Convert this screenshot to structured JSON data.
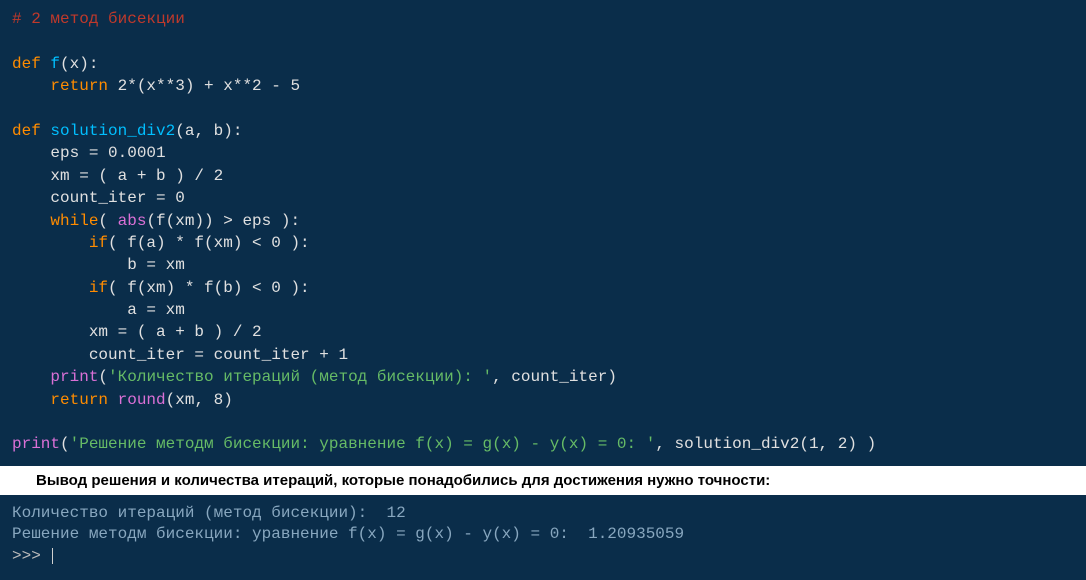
{
  "code": {
    "l1_comment": "# 2 метод бисекции",
    "l3_def": "def ",
    "l3_fname": "f",
    "l3_rest": "(x):",
    "l4_kw": "    return ",
    "l4_rest": "2*(x**3) + x**2 - 5",
    "l6_def": "def ",
    "l6_fname": "solution_div2",
    "l6_rest": "(a, b):",
    "l7": "    eps = 0.0001",
    "l8": "    xm = ( a + b ) / 2",
    "l9": "    count_iter = 0",
    "l10_kw": "    while",
    "l10_rest_a": "( ",
    "l10_abs": "abs",
    "l10_rest_b": "(f(xm)) > eps ):",
    "l11_kw": "        if",
    "l11_rest": "( f(a) * f(xm) < 0 ):",
    "l12": "            b = xm",
    "l13_kw": "        if",
    "l13_rest": "( f(xm) * f(b) < 0 ):",
    "l14": "            a = xm",
    "l15": "        xm = ( a + b ) / 2",
    "l16": "        count_iter = count_iter + 1",
    "l17_pr": "    print",
    "l17_p1": "(",
    "l17_str": "'Количество итераций (метод бисекции): '",
    "l17_rest": ", count_iter)",
    "l18_kw": "    return ",
    "l18_round": "round",
    "l18_rest": "(xm, 8)",
    "l20_pr": "print",
    "l20_p1": "(",
    "l20_str": "'Решение методм бисекции: уравнение f(x) = g(x) - y(x) = 0: '",
    "l20_rest": ", solution_div2(1, 2) )"
  },
  "caption": "Вывод решения и количества итераций, которые понадобились для достижения нужно точности:",
  "console": {
    "line1": "Количество итераций (метод бисекции):  12",
    "line2": "Решение методм бисекции: уравнение f(x) = g(x) - y(x) = 0:  1.20935059",
    "prompt": ">>> "
  }
}
